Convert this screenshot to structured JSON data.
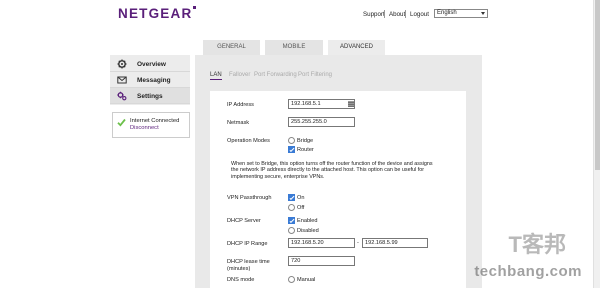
{
  "header": {
    "logo": "NETGEAR",
    "links": [
      "Support",
      "About",
      "Logout"
    ],
    "language": "English"
  },
  "tabs": [
    "GENERAL",
    "MOBILE",
    "ADVANCED"
  ],
  "sidebar": {
    "items": [
      {
        "label": "Overview",
        "icon": "gear-icon"
      },
      {
        "label": "Messaging",
        "icon": "envelope-icon"
      },
      {
        "label": "Settings",
        "icon": "gears-icon"
      }
    ],
    "status": {
      "title": "Internet Connected",
      "action": "Disconnect"
    }
  },
  "subtabs": [
    "LAN",
    "Fallover",
    "Port Forwarding",
    "Port Filtering"
  ],
  "form": {
    "ip_label": "IP Address",
    "ip_value": "192.168.5.1",
    "netmask_label": "Netmask",
    "netmask_value": "255.255.255.0",
    "opmodes_label": "Operation Modes",
    "bridge": "Bridge",
    "router": "Router",
    "description": "When set to Bridge, this option turns off the router function of the device and assigns the network IP address directly to the attached host. This option can be useful for implementing secure, enterprise VPNs.",
    "vpn_label": "VPN Passthrough",
    "vpn_on": "On",
    "vpn_off": "Off",
    "dhcp_label": "DHCP Server",
    "dhcp_enabled": "Enabled",
    "dhcp_disabled": "Disabled",
    "range_label": "DHCP IP Range",
    "range_start": "192.168.5.20",
    "range_dash": "-",
    "range_end": "192.168.5.99",
    "lease_label": "DHCP lease time (minutes)",
    "lease_value": "720",
    "dns_label": "DNS mode",
    "dns_manual": "Manual"
  },
  "watermark": {
    "site": "techbang.com",
    "mark": "T客邦"
  },
  "colors": {
    "brand": "#5a1f7a",
    "accent": "#3a7bd5",
    "status_ok": "#6cc04a"
  }
}
